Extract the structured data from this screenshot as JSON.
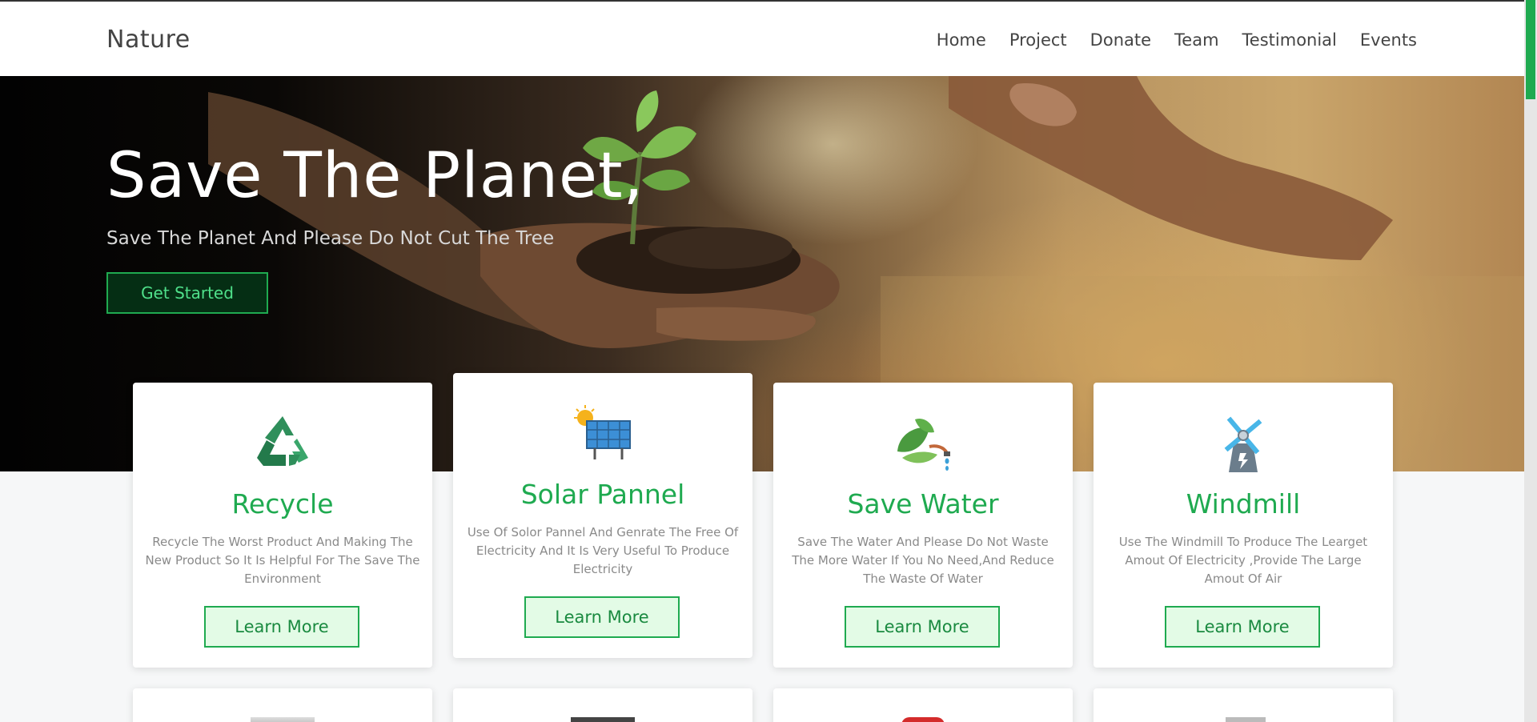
{
  "navbar": {
    "brand": "Nature",
    "items": [
      {
        "label": "Home"
      },
      {
        "label": "Project"
      },
      {
        "label": "Donate"
      },
      {
        "label": "Team"
      },
      {
        "label": "Testimonial"
      },
      {
        "label": "Events"
      }
    ]
  },
  "hero": {
    "title": "Save The Planet,",
    "subtitle": "Save The Planet And Please Do Not Cut The Tree",
    "cta_label": "Get Started"
  },
  "cards": [
    {
      "icon": "recycle-icon",
      "title": "Recycle",
      "description": "Recycle The Worst Product And Making The New Product So It Is Helpful For The Save The Environment",
      "button_label": "Learn More"
    },
    {
      "icon": "solar-panel-icon",
      "title": "Solar Pannel",
      "description": "Use Of Solor Pannel And Genrate The Free Of Electricity And It Is Very Useful To Produce Electricity",
      "button_label": "Learn More"
    },
    {
      "icon": "save-water-icon",
      "title": "Save Water",
      "description": "Save The Water And Please Do Not Waste The More Water If You No Need,And Reduce The Waste Of Water",
      "button_label": "Learn More"
    },
    {
      "icon": "windmill-icon",
      "title": "Windmill",
      "description": "Use The Windmill To Produce The Learget Amout Of Electricity ,Provide The Large Amout Of Air",
      "button_label": "Learn More"
    }
  ],
  "colors": {
    "accent": "#1faa50",
    "button_bg": "#e3fbe6",
    "text_muted": "#8a8a8a"
  }
}
